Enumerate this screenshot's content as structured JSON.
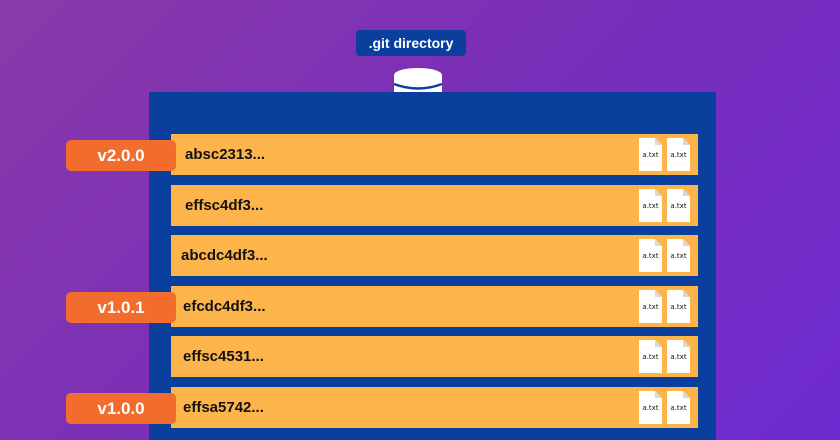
{
  "header": {
    "label": ".git directory"
  },
  "commits": [
    {
      "hash": "absc2313...",
      "files": [
        "a.txt",
        "a.txt"
      ]
    },
    {
      "hash": "effsc4df3...",
      "files": [
        "a.txt",
        "a.txt"
      ]
    },
    {
      "hash": "abcdc4df3...",
      "files": [
        "a.txt",
        "a.txt"
      ]
    },
    {
      "hash": "efcdc4df3...",
      "files": [
        "a.txt",
        "a.txt"
      ]
    },
    {
      "hash": "effsc4531...",
      "files": [
        "a.txt",
        "a.txt"
      ]
    },
    {
      "hash": "effsa5742...",
      "files": [
        "a.txt",
        "a.txt"
      ]
    }
  ],
  "tags": [
    {
      "label": "v2.0.0"
    },
    {
      "label": "v1.0.1"
    },
    {
      "label": "v1.0.0"
    }
  ],
  "colors": {
    "panel": "#0a3f9e",
    "row": "#fdb44b",
    "tag": "#f26c2e"
  },
  "icons": {
    "header": "database-icon",
    "file": "file-icon"
  }
}
